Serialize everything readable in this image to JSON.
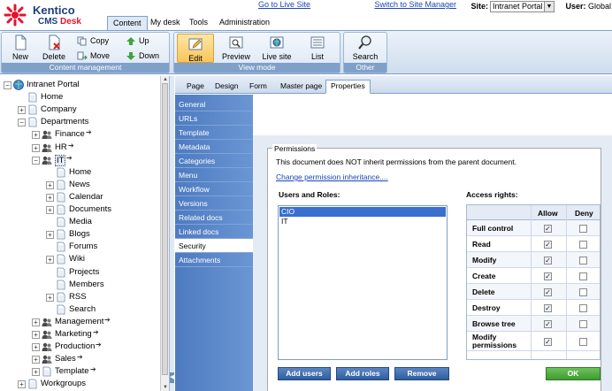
{
  "brand": {
    "name": "Kentico",
    "sub_prefix": "CMS",
    "sub_suffix": "Desk"
  },
  "top_links": {
    "live_site": "Go to Live Site",
    "site_manager": "Switch to Site Manager",
    "site_label": "Site:",
    "site_value": "Intranet Portal",
    "user_label": "User:",
    "user_value": "Global"
  },
  "main_tabs": [
    "Content",
    "My desk",
    "Tools",
    "Administration"
  ],
  "ribbon": {
    "new": "New",
    "delete": "Delete",
    "copy": "Copy",
    "move": "Move",
    "up": "Up",
    "down": "Down",
    "content_management": "Content management",
    "edit": "Edit",
    "preview": "Preview",
    "live_site": "Live site",
    "list": "List",
    "view_mode": "View mode",
    "search": "Search",
    "other": "Other"
  },
  "tree": [
    {
      "label": "Intranet Portal",
      "level": 0,
      "expander": "−",
      "icon": "globe-icon"
    },
    {
      "label": "Home",
      "level": 1,
      "expander": "",
      "icon": "document-icon"
    },
    {
      "label": "Company",
      "level": 1,
      "expander": "+",
      "icon": "document-icon"
    },
    {
      "label": "Departments",
      "level": 1,
      "expander": "−",
      "icon": "document-icon"
    },
    {
      "label": "Finance",
      "level": 2,
      "expander": "+",
      "icon": "group-icon",
      "arrow": "➔"
    },
    {
      "label": "HR",
      "level": 2,
      "expander": "+",
      "icon": "group-icon",
      "arrow": "➔"
    },
    {
      "label": "IT",
      "level": 2,
      "expander": "−",
      "icon": "group-icon",
      "arrow": "➔",
      "selected": true
    },
    {
      "label": "Home",
      "level": 3,
      "expander": "",
      "icon": "document-icon"
    },
    {
      "label": "News",
      "level": 3,
      "expander": "+",
      "icon": "document-icon"
    },
    {
      "label": "Calendar",
      "level": 3,
      "expander": "+",
      "icon": "document-icon"
    },
    {
      "label": "Documents",
      "level": 3,
      "expander": "+",
      "icon": "document-icon"
    },
    {
      "label": "Media",
      "level": 3,
      "expander": "",
      "icon": "document-icon"
    },
    {
      "label": "Blogs",
      "level": 3,
      "expander": "+",
      "icon": "document-icon"
    },
    {
      "label": "Forums",
      "level": 3,
      "expander": "",
      "icon": "document-icon"
    },
    {
      "label": "Wiki",
      "level": 3,
      "expander": "+",
      "icon": "document-icon"
    },
    {
      "label": "Projects",
      "level": 3,
      "expander": "",
      "icon": "document-icon"
    },
    {
      "label": "Members",
      "level": 3,
      "expander": "",
      "icon": "document-icon"
    },
    {
      "label": "RSS",
      "level": 3,
      "expander": "+",
      "icon": "document-icon"
    },
    {
      "label": "Search",
      "level": 3,
      "expander": "",
      "icon": "document-icon"
    },
    {
      "label": "Management",
      "level": 2,
      "expander": "+",
      "icon": "group-icon",
      "arrow": "➔"
    },
    {
      "label": "Marketing",
      "level": 2,
      "expander": "+",
      "icon": "group-icon",
      "arrow": "➔"
    },
    {
      "label": "Production",
      "level": 2,
      "expander": "+",
      "icon": "group-icon",
      "arrow": "➔"
    },
    {
      "label": "Sales",
      "level": 2,
      "expander": "+",
      "icon": "group-icon",
      "arrow": "➔"
    },
    {
      "label": "Template",
      "level": 2,
      "expander": "+",
      "icon": "document-icon",
      "arrow": "➔"
    },
    {
      "label": "Workgroups",
      "level": 1,
      "expander": "+",
      "icon": "document-icon"
    }
  ],
  "content_tabs": [
    "Page",
    "Design",
    "Form",
    "Master page",
    "Properties"
  ],
  "active_content_tab": 4,
  "vertical_tabs": [
    "General",
    "URLs",
    "Template",
    "Metadata",
    "Categories",
    "Menu",
    "Workflow",
    "Versions",
    "Related docs",
    "Linked docs",
    "Security",
    "Attachments"
  ],
  "active_vertical_tab": 10,
  "permissions": {
    "legend": "Permissions",
    "inherit_text": "This document does NOT inherit permissions from the parent document.",
    "change_link": "Change permission inheritance....",
    "users_roles_label": "Users and Roles:",
    "access_rights_label": "Access rights:",
    "roles": [
      "CIO",
      "IT"
    ],
    "selected_role": 0,
    "allow_header": "Allow",
    "deny_header": "Deny",
    "rights": [
      {
        "name": "Full control",
        "allow": true,
        "deny": false
      },
      {
        "name": "Read",
        "allow": true,
        "deny": false
      },
      {
        "name": "Modify",
        "allow": true,
        "deny": false
      },
      {
        "name": "Create",
        "allow": true,
        "deny": false
      },
      {
        "name": "Delete",
        "allow": true,
        "deny": false
      },
      {
        "name": "Destroy",
        "allow": true,
        "deny": false
      },
      {
        "name": "Browse tree",
        "allow": true,
        "deny": false
      },
      {
        "name": "Modify permissions",
        "allow": true,
        "deny": false
      }
    ],
    "add_users": "Add users",
    "add_roles": "Add roles",
    "remove": "Remove",
    "ok": "OK"
  }
}
